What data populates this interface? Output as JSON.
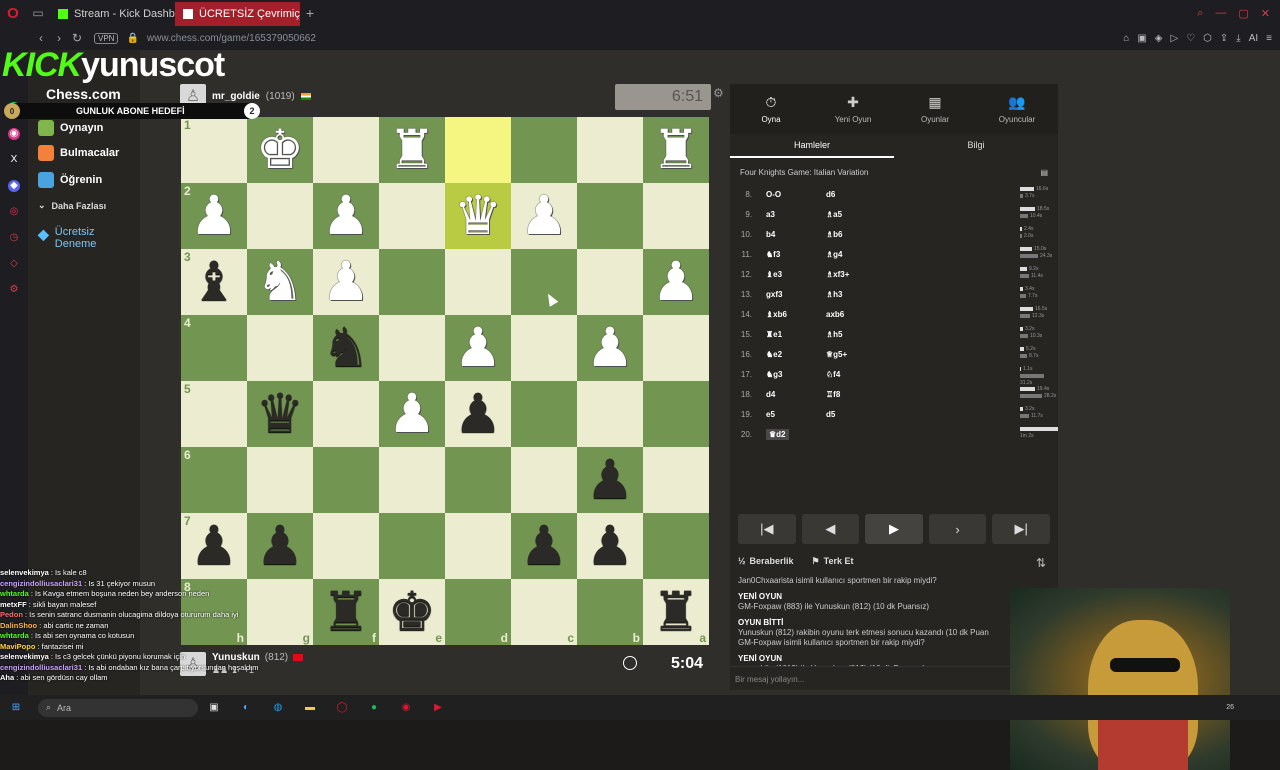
{
  "browser": {
    "tabs": [
      {
        "label": "Stream - Kick Dashboard",
        "active": false
      },
      {
        "label": "ÜCRETSİZ Çevrimiçi Satra",
        "active": true
      }
    ],
    "vpn": "VPN",
    "url": "www.chess.com/game/165379050662",
    "ai_label": "AI"
  },
  "overlay": {
    "kick": "KICK",
    "username": "yunuscot",
    "goal_count_left": "0",
    "goal_label": "GUNLUK ABONE HEDEFİ",
    "goal_count_right": "2"
  },
  "nav": {
    "logo": "Chess.com",
    "items": [
      {
        "label": "Oynayın",
        "color": "#81b64c"
      },
      {
        "label": "Bulmacalar",
        "color": "#f1813b"
      },
      {
        "label": "Öğrenin",
        "color": "#4aa3df"
      }
    ],
    "more": "Daha Fazlası",
    "premium": "Ücretsiz Deneme"
  },
  "top_player": {
    "name": "mr_goldie",
    "rating": "(1019)",
    "clock": "6:51"
  },
  "bottom_player": {
    "name": "Yunuskun",
    "rating": "(812)",
    "clock": "5:04",
    "extra": "+1"
  },
  "board": {
    "ranks": [
      "1",
      "2",
      "3",
      "4",
      "5",
      "6",
      "7",
      "8"
    ],
    "files": [
      "h",
      "g",
      "f",
      "e",
      "d",
      "c",
      "b",
      "a"
    ],
    "rows": [
      [
        {
          "p": "",
          "c": ""
        },
        {
          "p": "♚",
          "c": "w"
        },
        {
          "p": "",
          "c": ""
        },
        {
          "p": "♜",
          "c": "w"
        },
        {
          "p": "",
          "c": "",
          "hl": true
        },
        {
          "p": "",
          "c": ""
        },
        {
          "p": "",
          "c": ""
        },
        {
          "p": "♜",
          "c": "w"
        }
      ],
      [
        {
          "p": "♟",
          "c": "w"
        },
        {
          "p": "",
          "c": ""
        },
        {
          "p": "♟",
          "c": "w"
        },
        {
          "p": "",
          "c": ""
        },
        {
          "p": "♛",
          "c": "w",
          "hl": true
        },
        {
          "p": "♟",
          "c": "w"
        },
        {
          "p": "",
          "c": ""
        },
        {
          "p": "",
          "c": ""
        }
      ],
      [
        {
          "p": "♝",
          "c": "b"
        },
        {
          "p": "♞",
          "c": "w"
        },
        {
          "p": "♟",
          "c": "w"
        },
        {
          "p": "",
          "c": ""
        },
        {
          "p": "",
          "c": ""
        },
        {
          "p": "",
          "c": ""
        },
        {
          "p": "",
          "c": ""
        },
        {
          "p": "♟",
          "c": "w"
        }
      ],
      [
        {
          "p": "",
          "c": ""
        },
        {
          "p": "",
          "c": ""
        },
        {
          "p": "♞",
          "c": "b"
        },
        {
          "p": "",
          "c": ""
        },
        {
          "p": "♟",
          "c": "w"
        },
        {
          "p": "",
          "c": ""
        },
        {
          "p": "♟",
          "c": "w"
        },
        {
          "p": "",
          "c": ""
        }
      ],
      [
        {
          "p": "",
          "c": ""
        },
        {
          "p": "♛",
          "c": "b"
        },
        {
          "p": "",
          "c": ""
        },
        {
          "p": "♟",
          "c": "w"
        },
        {
          "p": "♟",
          "c": "b"
        },
        {
          "p": "",
          "c": ""
        },
        {
          "p": "",
          "c": ""
        },
        {
          "p": "",
          "c": ""
        }
      ],
      [
        {
          "p": "",
          "c": ""
        },
        {
          "p": "",
          "c": ""
        },
        {
          "p": "",
          "c": ""
        },
        {
          "p": "",
          "c": ""
        },
        {
          "p": "",
          "c": ""
        },
        {
          "p": "",
          "c": ""
        },
        {
          "p": "♟",
          "c": "b"
        },
        {
          "p": "",
          "c": ""
        }
      ],
      [
        {
          "p": "♟",
          "c": "b"
        },
        {
          "p": "♟",
          "c": "b"
        },
        {
          "p": "",
          "c": ""
        },
        {
          "p": "",
          "c": ""
        },
        {
          "p": "",
          "c": ""
        },
        {
          "p": "♟",
          "c": "b"
        },
        {
          "p": "♟",
          "c": "b"
        },
        {
          "p": "",
          "c": ""
        }
      ],
      [
        {
          "p": "",
          "c": ""
        },
        {
          "p": "",
          "c": ""
        },
        {
          "p": "♜",
          "c": "b"
        },
        {
          "p": "♚",
          "c": "b"
        },
        {
          "p": "",
          "c": ""
        },
        {
          "p": "",
          "c": ""
        },
        {
          "p": "",
          "c": ""
        },
        {
          "p": "♜",
          "c": "b"
        }
      ]
    ]
  },
  "panel": {
    "tabs": [
      {
        "label": "Oyna",
        "icon": "⏱",
        "active": true
      },
      {
        "label": "Yeni Oyun",
        "icon": "✚",
        "active": false
      },
      {
        "label": "Oyunlar",
        "icon": "▦",
        "active": false
      },
      {
        "label": "Oyuncular",
        "icon": "👥",
        "active": false
      }
    ],
    "sub_tabs": [
      "Hamleler",
      "Bilgi"
    ],
    "opening": "Four Knights Game: Italian Variation",
    "moves": [
      {
        "n": "8.",
        "w": "O-O",
        "b": "d6",
        "t1": "16.6s",
        "t2": "3.7s",
        "w1": 14,
        "w2": 3
      },
      {
        "n": "9.",
        "w": "a3",
        "b": "♗a5",
        "t1": "18.5s",
        "t2": "10.4s",
        "w1": 15,
        "w2": 8
      },
      {
        "n": "10.",
        "w": "b4",
        "b": "♗b6",
        "t1": "2.4s",
        "t2": "2.0s",
        "w1": 2,
        "w2": 2
      },
      {
        "n": "11.",
        "w": "♞f3",
        "b": "♗g4",
        "t1": "15.0s",
        "t2": "24.3s",
        "w1": 12,
        "w2": 18
      },
      {
        "n": "12.",
        "w": "♝e3",
        "b": "♗xf3+",
        "t1": "9.2s",
        "t2": "11.4s",
        "w1": 7,
        "w2": 9
      },
      {
        "n": "13.",
        "w": "gxf3",
        "b": "♗h3",
        "t1": "3.4s",
        "t2": "7.7s",
        "w1": 3,
        "w2": 6
      },
      {
        "n": "14.",
        "w": "♝xb6",
        "b": "axb6",
        "t1": "16.5s",
        "t2": "12.3s",
        "w1": 13,
        "w2": 10
      },
      {
        "n": "15.",
        "w": "♜e1",
        "b": "♗h5",
        "t1": "3.2s",
        "t2": "10.3s",
        "w1": 3,
        "w2": 8
      },
      {
        "n": "16.",
        "w": "♞e2",
        "b": "♕g5+",
        "t1": "5.2s",
        "t2": "8.7s",
        "w1": 4,
        "w2": 7
      },
      {
        "n": "17.",
        "w": "♞g3",
        "b": "♘f4",
        "t1": "1.1s",
        "t2": "31.2s",
        "w1": 1,
        "w2": 24
      },
      {
        "n": "18.",
        "w": "d4",
        "b": "♖f8",
        "t1": "19.4s",
        "t2": "28.2s",
        "w1": 15,
        "w2": 22
      },
      {
        "n": "19.",
        "w": "e5",
        "b": "d5",
        "t1": "3.2s",
        "t2": "11.7s",
        "w1": 3,
        "w2": 9
      },
      {
        "n": "20.",
        "w": "♛d2",
        "b": "",
        "t1": "1m 2s",
        "t2": "",
        "w1": 40,
        "w2": 0
      }
    ],
    "draw": "Beraberlik",
    "resign": "Terk Et",
    "feed": [
      {
        "h": "",
        "t": "Jan0Chxaarista isimli kullanıcı sportmen bir rakip miydi?"
      },
      {
        "h": "YENİ OYUN",
        "t": "GM-Foxpaw (883) ile Yunuskun (812) (10 dk Puansız)"
      },
      {
        "h": "OYUN BİTTİ",
        "t": "Yunuskun (812) rakibin oyunu terk etmesi sonucu kazandı (10 dk Puan"
      },
      {
        "h": "",
        "t": "GM-Foxpaw isimli kullanıcı sportmen bir rakip miydi?"
      },
      {
        "h": "YENİ OYUN",
        "t": "mr_goldie (1019) ile Yunuskun (812) (10 dk Puansız)"
      }
    ],
    "message_placeholder": "Bir mesaj yollayın..."
  },
  "chat": [
    {
      "u": "selenvekimya",
      "m": ": Is kale c8",
      "c": "#ffffff"
    },
    {
      "u": "cengizindolliusaclari31",
      "m": ": Is 31 çekiyor musun",
      "c": "#c7a0ff"
    },
    {
      "u": "whtarda",
      "m": ": Is Kavga etmem boşuna neden bey anderson neden",
      "c": "#53fc18"
    },
    {
      "u": "metxFF",
      "m": ": sikli bayan malesef",
      "c": "#ffffff"
    },
    {
      "u": "Pedon",
      "m": ": Is senin satranc dusmanin olucagima dildoya otururum daha iyi",
      "c": "#ff6b6b"
    },
    {
      "u": "DalinShoo",
      "m": ": abi cartic ne zaman",
      "c": "#ffb347"
    },
    {
      "u": "whtarda",
      "m": ": Is abi sen oynama co kotusun",
      "c": "#53fc18"
    },
    {
      "u": "MaviPopo",
      "m": ": fantazisei mi",
      "c": "#ffd24a"
    },
    {
      "u": "selenvekimya",
      "m": ": Is c3 gelcek çünkü piyonu korumak için",
      "c": "#ffffff"
    },
    {
      "u": "cengizindolliusaclari31",
      "m": ": Is abi ondaban kız bana çarpıtıyorsundan hoşaldım",
      "c": "#c7a0ff"
    },
    {
      "u": "Aha",
      "m": ": abi sen gördüsn cay ollam",
      "c": "#ffffff"
    }
  ],
  "taskbar": {
    "search": "Ara",
    "clock": "26"
  }
}
